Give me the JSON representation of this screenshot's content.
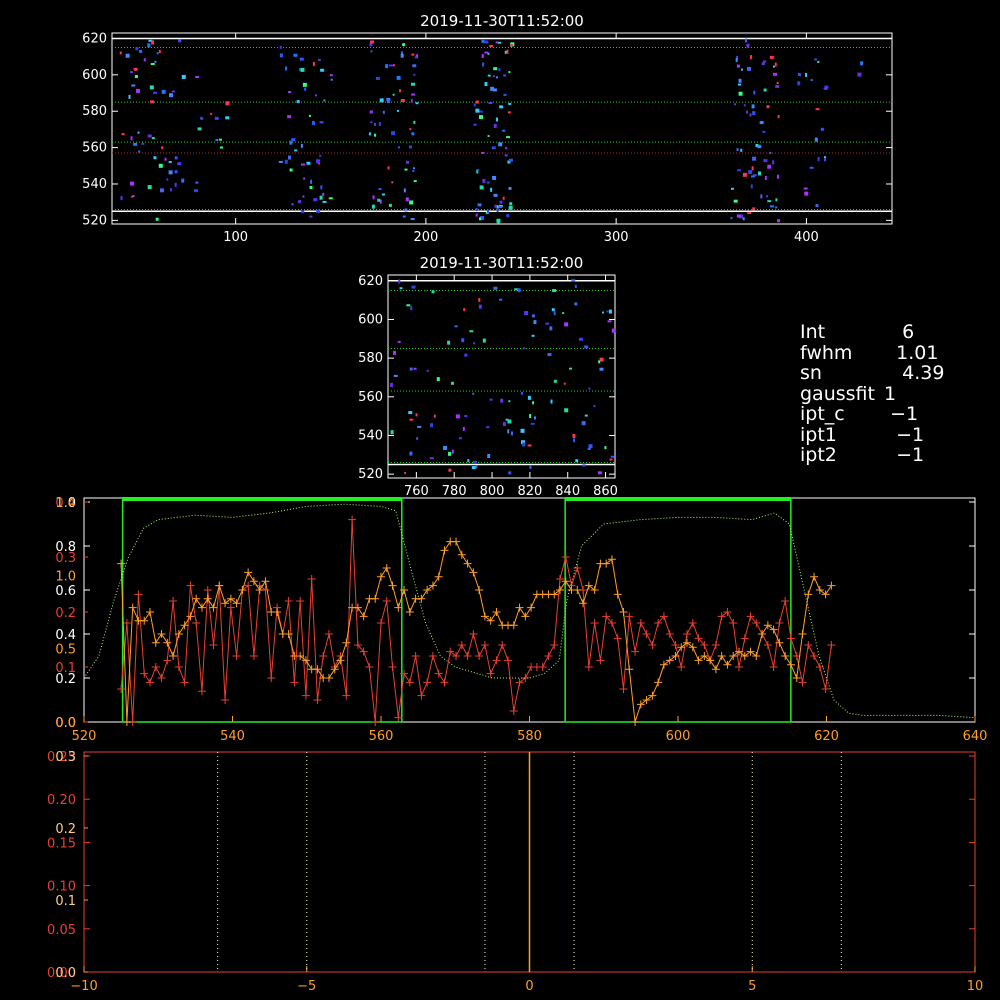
{
  "chart_data": [
    {
      "id": "top",
      "type": "scatter",
      "title": "2019-11-30T11:52:00",
      "xlim": [
        35,
        445
      ],
      "ylim": [
        518,
        623
      ],
      "xticks": [
        100,
        200,
        300,
        400
      ],
      "yticks": [
        520,
        540,
        560,
        580,
        600,
        620
      ],
      "hlines": [
        {
          "y": 620,
          "color": "#ffffff",
          "style": "solid"
        },
        {
          "y": 525,
          "color": "#ffffff",
          "style": "solid"
        },
        {
          "y": 615,
          "color": "#22cc22",
          "style": "dotted"
        },
        {
          "y": 585,
          "color": "#22cc22",
          "style": "dotted"
        },
        {
          "y": 563,
          "color": "#22cc22",
          "style": "dotted"
        },
        {
          "y": 557,
          "color": "#cc2222",
          "style": "dotted"
        },
        {
          "y": 526,
          "color": "#22cc22",
          "style": "dotted"
        }
      ],
      "clusters": [
        {
          "xmin": 36,
          "xmax": 72,
          "ymin": 520,
          "ymax": 622,
          "n": 55
        },
        {
          "xmin": 78,
          "xmax": 95,
          "ymin": 530,
          "ymax": 600,
          "n": 12
        },
        {
          "xmin": 122,
          "xmax": 150,
          "ymin": 520,
          "ymax": 622,
          "n": 50
        },
        {
          "xmin": 170,
          "xmax": 195,
          "ymin": 520,
          "ymax": 622,
          "n": 60
        },
        {
          "xmin": 225,
          "xmax": 245,
          "ymin": 520,
          "ymax": 622,
          "n": 75
        },
        {
          "xmin": 360,
          "xmax": 385,
          "ymin": 520,
          "ymax": 622,
          "n": 65
        },
        {
          "xmin": 395,
          "xmax": 410,
          "ymin": 525,
          "ymax": 612,
          "n": 18
        },
        {
          "xmin": 425,
          "xmax": 430,
          "ymin": 600,
          "ymax": 608,
          "n": 2
        }
      ]
    },
    {
      "id": "mid",
      "type": "scatter",
      "title": "2019-11-30T11:52:00",
      "xlim": [
        745,
        865
      ],
      "ylim": [
        518,
        623
      ],
      "xticks": [
        760,
        780,
        800,
        820,
        840,
        860
      ],
      "yticks": [
        520,
        540,
        560,
        580,
        600,
        620
      ],
      "hlines": [
        {
          "y": 620,
          "color": "#ffffff",
          "style": "solid"
        },
        {
          "y": 525,
          "color": "#ffffff",
          "style": "solid"
        },
        {
          "y": 615,
          "color": "#22cc22",
          "style": "dotted"
        },
        {
          "y": 585,
          "color": "#22cc22",
          "style": "dotted"
        },
        {
          "y": 563,
          "color": "#22cc22",
          "style": "dotted"
        },
        {
          "y": 526,
          "color": "#22cc22",
          "style": "dotted"
        }
      ],
      "clusters": [
        {
          "xmin": 746,
          "xmax": 864,
          "ymin": 520,
          "ymax": 622,
          "n": 120
        }
      ]
    },
    {
      "id": "profile",
      "type": "line",
      "xlim": [
        520,
        640
      ],
      "xticks": [
        520,
        540,
        560,
        580,
        600,
        620,
        640
      ],
      "left_ticks_white": [
        {
          "label": "0.0",
          "f": 0.0
        },
        {
          "label": "0.2",
          "f": 0.2
        },
        {
          "label": "0.4",
          "f": 0.4
        },
        {
          "label": "0.6",
          "f": 0.6
        },
        {
          "label": "0.8",
          "f": 0.8
        },
        {
          "label": "1.0",
          "f": 1.0
        }
      ],
      "left_ticks_red": [
        {
          "label": "0.0",
          "f": 0.0
        },
        {
          "label": "0.1",
          "f": 0.25
        },
        {
          "label": "0.2",
          "f": 0.5
        },
        {
          "label": "0.3",
          "f": 0.75
        },
        {
          "label": "0.4",
          "f": 1.0
        }
      ],
      "left_ticks_orange": [
        {
          "label": "0.0",
          "f": 0.0
        },
        {
          "label": "0.5",
          "f": 0.333
        },
        {
          "label": "1.0",
          "f": 0.667
        },
        {
          "label": "1.4",
          "f": 1.0
        }
      ],
      "green_boxes": [
        {
          "x0": 525.2,
          "x1": 562.8
        },
        {
          "x0": 584.8,
          "x1": 615.2
        }
      ],
      "series": [
        {
          "color": "#e84030",
          "x0": 525,
          "dx": 1,
          "values": [
            0.15,
            0.45,
            0.0,
            0.58,
            0.22,
            0.18,
            0.25,
            0.2,
            0.28,
            0.55,
            0.25,
            0.18,
            0.62,
            0.45,
            0.14,
            0.6,
            0.35,
            0.62,
            0.1,
            0.52,
            0.3,
            0.6,
            0.62,
            0.3,
            0.62,
            0.6,
            0.2,
            0.52,
            0.4,
            0.55,
            0.18,
            0.55,
            0.12,
            0.65,
            0.1,
            0.3,
            0.4,
            0.25,
            0.3,
            0.12,
            0.92,
            0.35,
            0.32,
            0.25,
            0.0,
            0.45,
            0.55,
            0.25,
            0.02,
            0.22,
            0.18,
            0.3,
            0.12,
            0.18,
            0.3,
            0.22,
            0.18,
            0.32,
            0.3,
            0.35,
            0.3,
            0.4,
            0.3,
            0.35,
            0.22,
            0.28,
            0.35,
            0.28,
            0.05,
            0.18,
            0.2,
            0.25,
            0.25,
            0.25,
            0.3,
            0.35,
            0.65,
            0.75,
            0.62,
            0.7,
            0.6,
            0.25,
            0.45,
            0.28,
            0.48,
            0.45,
            0.38,
            0.15,
            0.48,
            0.32,
            0.45,
            0.4,
            0.35,
            0.45,
            0.48,
            0.4,
            0.35,
            0.25,
            0.4,
            0.45,
            0.38,
            0.35,
            0.28,
            0.35,
            0.48,
            0.5,
            0.45,
            0.25,
            0.38,
            0.48,
            0.45,
            0.4,
            0.35,
            0.25,
            0.45,
            0.55,
            0.38,
            0.3,
            0.18,
            0.35,
            0.3,
            0.25,
            0.15,
            0.35
          ]
        },
        {
          "color": "#ff9f2a",
          "x0": 525,
          "dx": 1,
          "values": [
            0.72,
            0.0,
            0.52,
            0.46,
            0.46,
            0.5,
            0.36,
            0.4,
            0.36,
            0.3,
            0.4,
            0.44,
            0.48,
            0.56,
            0.52,
            0.56,
            0.52,
            0.62,
            0.54,
            0.56,
            0.54,
            0.6,
            0.68,
            0.64,
            0.6,
            0.64,
            0.5,
            0.5,
            0.4,
            0.4,
            0.3,
            0.3,
            0.28,
            0.24,
            0.24,
            0.2,
            0.2,
            0.24,
            0.28,
            0.36,
            0.52,
            0.52,
            0.48,
            0.56,
            0.56,
            0.66,
            0.7,
            0.62,
            0.52,
            0.6,
            0.5,
            0.56,
            0.56,
            0.6,
            0.62,
            0.66,
            0.78,
            0.82,
            0.82,
            0.76,
            0.72,
            0.68,
            0.6,
            0.48,
            0.46,
            0.5,
            0.44,
            0.44,
            0.44,
            0.52,
            0.48,
            0.52,
            0.58,
            0.58,
            0.58,
            0.58,
            0.6,
            0.64,
            0.6,
            0.6,
            0.54,
            0.62,
            0.6,
            0.72,
            0.72,
            0.74,
            0.58,
            0.5,
            0.24,
            0.0,
            0.08,
            0.1,
            0.12,
            0.18,
            0.26,
            0.28,
            0.3,
            0.34,
            0.36,
            0.34,
            0.28,
            0.3,
            0.28,
            0.24,
            0.3,
            0.26,
            0.3,
            0.32,
            0.3,
            0.32,
            0.3,
            0.4,
            0.44,
            0.42,
            0.36,
            0.3,
            0.26,
            0.2,
            0.4,
            0.58,
            0.66,
            0.6,
            0.58,
            0.62
          ]
        },
        {
          "color": "#b0ff60",
          "style": "dotted",
          "points": [
            [
              520,
              0.2
            ],
            [
              522,
              0.3
            ],
            [
              524,
              0.55
            ],
            [
              526,
              0.75
            ],
            [
              528,
              0.88
            ],
            [
              530,
              0.92
            ],
            [
              535,
              0.94
            ],
            [
              540,
              0.93
            ],
            [
              545,
              0.95
            ],
            [
              550,
              0.98
            ],
            [
              555,
              0.99
            ],
            [
              560,
              0.98
            ],
            [
              562,
              0.96
            ],
            [
              564,
              0.7
            ],
            [
              566,
              0.45
            ],
            [
              568,
              0.3
            ],
            [
              570,
              0.25
            ],
            [
              575,
              0.2
            ],
            [
              580,
              0.2
            ],
            [
              582,
              0.22
            ],
            [
              584,
              0.28
            ],
            [
              585,
              0.55
            ],
            [
              587,
              0.8
            ],
            [
              590,
              0.9
            ],
            [
              595,
              0.92
            ],
            [
              600,
              0.93
            ],
            [
              605,
              0.93
            ],
            [
              610,
              0.92
            ],
            [
              613,
              0.95
            ],
            [
              615,
              0.9
            ],
            [
              617,
              0.6
            ],
            [
              619,
              0.3
            ],
            [
              621,
              0.1
            ],
            [
              623,
              0.04
            ],
            [
              625,
              0.03
            ],
            [
              630,
              0.03
            ],
            [
              635,
              0.03
            ],
            [
              640,
              0.02
            ]
          ]
        }
      ]
    },
    {
      "id": "bottom",
      "type": "line",
      "xlim": [
        -10,
        10
      ],
      "xticks": [
        -10,
        -5,
        0,
        5,
        10
      ],
      "left_ticks_white": [
        {
          "label": "0.0",
          "f": 0.0
        },
        {
          "label": "0.1",
          "f": 0.333
        },
        {
          "label": "0.2",
          "f": 0.667
        },
        {
          "label": "0.3",
          "f": 1.0
        }
      ],
      "left_ticks_red": [
        {
          "label": "0.00",
          "f": 0.0
        },
        {
          "label": "0.05",
          "f": 0.2
        },
        {
          "label": "0.10",
          "f": 0.4
        },
        {
          "label": "0.15",
          "f": 0.6
        },
        {
          "label": "0.20",
          "f": 0.8
        },
        {
          "label": "0.25",
          "f": 1.0
        }
      ],
      "vlines_dotted": [
        -7,
        -5,
        -1,
        1,
        5,
        7
      ],
      "vline_center": 0
    }
  ],
  "info": [
    {
      "key": "Int",
      "value": "    6"
    },
    {
      "key": "fwhm",
      "value": "   1.01"
    },
    {
      "key": "sn",
      "value": "    4.39"
    },
    {
      "key": "gaussfit",
      "value": " 1"
    },
    {
      "key": "ipt_c",
      "value": "  −1"
    },
    {
      "key": "ipt1",
      "value": "   −1"
    },
    {
      "key": "ipt2",
      "value": "   −1"
    }
  ]
}
